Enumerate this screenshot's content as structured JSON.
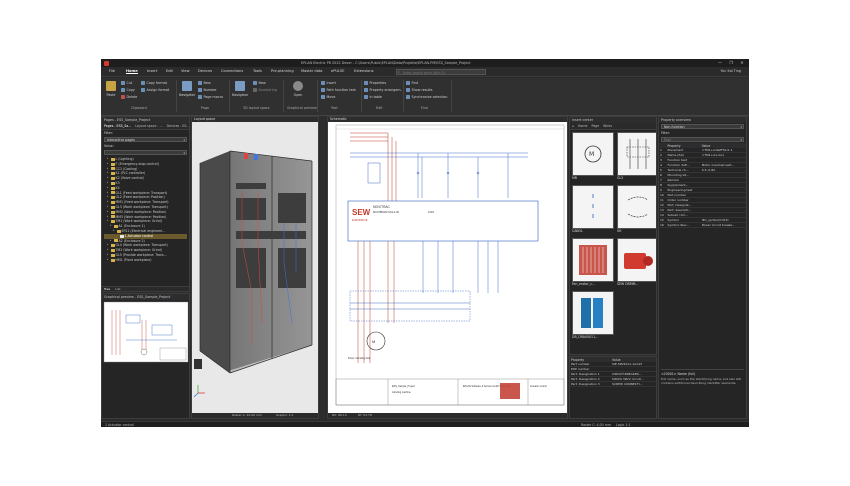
{
  "titlebar": {
    "title": "EPLAN Electric P8 2022 Dever - C:\\Users\\Public\\EPLAN\\Data\\Projekte\\EPLAN-PM\\ESS_Sample_Project",
    "controls": [
      "—",
      "❐",
      "✕"
    ]
  },
  "menu": {
    "tabs": [
      "File",
      "Home",
      "Insert",
      "Edit",
      "View",
      "Devices",
      "Connections",
      "Tools",
      "Pre-planning",
      "Master data",
      "ePULSE",
      "Extensions"
    ],
    "active": "Home",
    "search_placeholder": "Enter search term (Alt+Q)",
    "user": "Yun Kai Ting"
  },
  "ribbon": {
    "clipboard": {
      "paste": "Paste",
      "cut": "Cut",
      "copy": "Copy",
      "delete": "Delete",
      "copy_format": "Copy format",
      "assign_format": "Assign format",
      "label": "Clipboard"
    },
    "page": {
      "navigator": "Navigator",
      "new": "New",
      "number": "Number",
      "page_macro": "Page macro",
      "label": "Page"
    },
    "layout3d": {
      "navigator": "Navigator",
      "new": "New",
      "numbering": "Numbering",
      "label": "3D layout space"
    },
    "graphical_preview": {
      "open": "Open",
      "label": "Graphical preview"
    },
    "text": {
      "insert": "Insert",
      "path_function_text": "Path function text",
      "move": "Move",
      "label": "Text"
    },
    "edit": {
      "properties": "Properties",
      "property_arrangement": "Property arrangem.",
      "in_table": "In table",
      "label": "Edit"
    },
    "find": {
      "find": "Find",
      "show_results": "Show results",
      "synchronize_selection": "Synchronize selection",
      "label": "Find"
    }
  },
  "pages_panel": {
    "title": "Pages - ESS_Sample_Project",
    "tabs": [
      "Pages - ESS_Sa...",
      "Layout space - ...",
      "Devices - ES..."
    ],
    "filter_label": "Filter:",
    "filter_value": "Interactive pages",
    "value_label": "Value:",
    "tree": [
      {
        "label": "L (Lighting)",
        "indent": 1,
        "sel": false
      },
      {
        "label": "F (Emergency-stop control)",
        "indent": 1,
        "sel": false
      },
      {
        "label": "CC1 (Cooling)",
        "indent": 1,
        "sel": false
      },
      {
        "label": "K1 (PLC controller)",
        "indent": 1,
        "sel": false
      },
      {
        "label": "K2 (Valve control)",
        "indent": 1,
        "sel": false
      },
      {
        "label": "K3",
        "indent": 1,
        "sel": false
      },
      {
        "label": "K4",
        "indent": 1,
        "sel": false
      },
      {
        "label": "GL1 (Feed workpiece: Transport)",
        "indent": 1,
        "sel": false
      },
      {
        "label": "GL2 (Feed workpiece: Position)",
        "indent": 1,
        "sel": false
      },
      {
        "label": "MM1 (Feed workpiece: Transport)",
        "indent": 1,
        "sel": false
      },
      {
        "label": "GL3 (Work workpiece: Transport)",
        "indent": 1,
        "sel": false
      },
      {
        "label": "MM2 (Work workpiece: Position)",
        "indent": 1,
        "sel": false
      },
      {
        "label": "MM3 (Work workpiece: Position)",
        "indent": 1,
        "sel": false
      },
      {
        "label": "TM1 (Work workpiece: Grind)",
        "indent": 1,
        "sel": false
      },
      {
        "label": "A1 (Enclosure 1)",
        "indent": 2,
        "sel": false
      },
      {
        "label": "EFS1 (Electrical engineeri...",
        "indent": 3,
        "sel": false
      },
      {
        "label": "1 Actuator control",
        "indent": 4,
        "sel": true
      },
      {
        "label": "A2 (Enclosure 2)",
        "indent": 2,
        "sel": false
      },
      {
        "label": "GL4 (Work workpiece: Transport)",
        "indent": 1,
        "sel": false
      },
      {
        "label": "TM2 (Work workpiece: Grind)",
        "indent": 1,
        "sel": false
      },
      {
        "label": "GL5 (Provide workpiece: Trans...",
        "indent": 1,
        "sel": false
      },
      {
        "label": "HM1 (Plant workpiece)",
        "indent": 1,
        "sel": false
      }
    ],
    "bottom_tabs": [
      "Tree",
      "List"
    ]
  },
  "preview_panel": {
    "title": "Graphical preview - ESS_Sample_Project"
  },
  "layout_view": {
    "vtab_label": "Layout space",
    "status": {
      "raster": "Raster A: 10.00 mm",
      "graphic": "Graphic 1:1"
    }
  },
  "schematic_view": {
    "vtab_label": "Schematic",
    "brand": "SEW",
    "brand_sub": "EURODRIVE",
    "device_label": "MOVITRAC",
    "device_code": "MC07B0022-5A3-4-00",
    "device_id": "L003",
    "motor_label": "Drive: Grinding belt",
    "title_block": {
      "company": "EPLAN Software & Service GmbH & Co. KG",
      "description": "Actuator control",
      "project": "ESS_Sample_Project",
      "sub": "Grinding machine"
    },
    "status": {
      "coords": "RX: 66.13",
      "ry": "RY: 63.78",
      "raster": "Raster C: 4.00 mm",
      "logic": "Logic 1:1"
    }
  },
  "insert_center": {
    "title": "Insert center",
    "breadcrumb": [
      "Home",
      "Page",
      "Wires"
    ],
    "items": [
      {
        "caption": "MB"
      },
      {
        "caption": "GL2"
      },
      {
        "caption": "CABOL"
      },
      {
        "caption": "SH"
      },
      {
        "caption": "Fan_motor_c..."
      },
      {
        "caption": "SEW DRMM..."
      },
      {
        "caption": "DB_DRA00011..."
      }
    ]
  },
  "property_panel_bottom": {
    "headers": [
      "Property",
      "Value"
    ],
    "rows": [
      {
        "p": "Part number",
        "v": "SIE.3RV2011-1AA15"
      },
      {
        "p": "ERP number",
        "v": ""
      },
      {
        "p": "Part: Designation 1",
        "v": "CIRCUIT-BREAKER..."
      },
      {
        "p": "Part: Designation 2",
        "v": "SIRIUS 3RV2 circuit..."
      },
      {
        "p": "Part: Designation 3",
        "v": "SCREW CONNECTI..."
      }
    ]
  },
  "property_overview": {
    "title": "Property overview",
    "combo_value": "Non-function",
    "filter_label": "Filter:",
    "find_placeholder": "Find",
    "headers": [
      "",
      "Property",
      "Value"
    ],
    "rows": [
      {
        "n": "1",
        "p": "Placement",
        "v": "=TM1+A1&EFS1/1.1"
      },
      {
        "n": "2",
        "p": "Name (full)",
        "v": "=TM1+A1-GL1"
      },
      {
        "n": "3",
        "p": "Function text",
        "v": ""
      },
      {
        "n": "4",
        "p": "Function defi...",
        "v": "Motor overload swit..."
      },
      {
        "n": "5",
        "p": "Technical ch...",
        "v": "0.5..0.8A"
      },
      {
        "n": "6",
        "p": "Mounting sit...",
        "v": ""
      },
      {
        "n": "7",
        "p": "Remark",
        "v": ""
      },
      {
        "n": "8",
        "p": "Supplement...",
        "v": ""
      },
      {
        "n": "9",
        "p": "Engineering test",
        "v": ""
      },
      {
        "n": "10",
        "p": "Part number",
        "v": ""
      },
      {
        "n": "11",
        "p": "Order number",
        "v": ""
      },
      {
        "n": "12",
        "p": "Part: Designat...",
        "v": ""
      },
      {
        "n": "13",
        "p": "Part: descripti...",
        "v": ""
      },
      {
        "n": "14",
        "p": "Subset / lim...",
        "v": ""
      },
      {
        "n": "15",
        "p": "Symbol",
        "v": "IEC_symbol/1315l"
      },
      {
        "n": "16",
        "p": "Symbol desc...",
        "v": "Power circuit breake..."
      }
    ],
    "help_title": "<20001> Name (full)",
    "help_text": "Full name, such as the identifying name, but also still contains additional describing identifier elements."
  },
  "statusbar": {
    "left": "1 Actuator control"
  },
  "colors": {
    "accent": "#d8b24a",
    "panel": "#252526",
    "ribbon": "#303030",
    "selection": "#6b5a2c"
  }
}
